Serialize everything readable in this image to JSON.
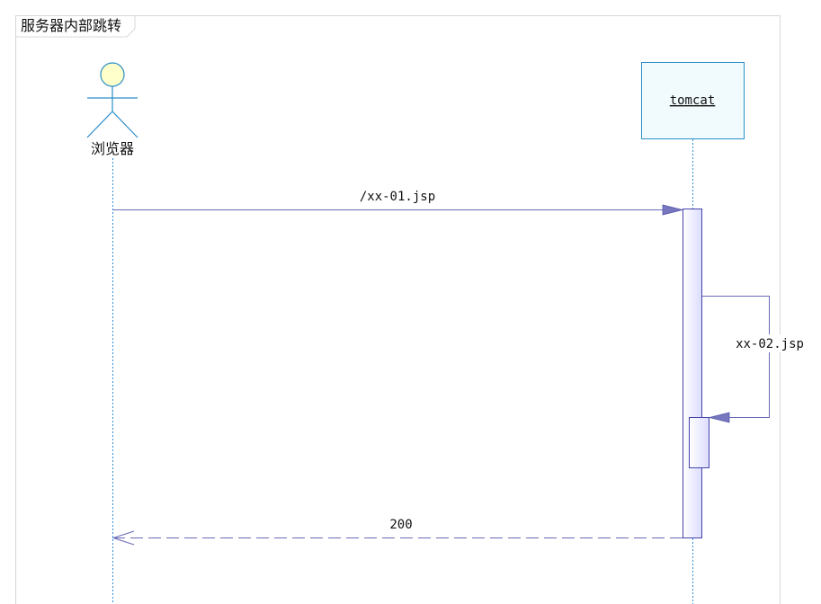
{
  "frame": {
    "title": "服务器内部跳转"
  },
  "participants": [
    {
      "id": "browser",
      "label": "浏览器",
      "kind": "actor"
    },
    {
      "id": "tomcat",
      "label": "tomcat",
      "kind": "object"
    }
  ],
  "messages": [
    {
      "label": "/xx-01.jsp",
      "from": "浏览器",
      "to": "tomcat",
      "style": "solid"
    },
    {
      "label": "xx-02.jsp",
      "from": "tomcat",
      "to": "tomcat",
      "style": "solid"
    },
    {
      "label": "200",
      "from": "tomcat",
      "to": "浏览器",
      "style": "dashed"
    }
  ],
  "colors": {
    "frame_border": "#d8d8d8",
    "lifeline": "#2f8fd8",
    "object_border": "#2a8fc8",
    "object_fill": "#f1fbfe",
    "actor_stroke": "#2a8fc8",
    "actor_head_fill": "#ffffcc",
    "message_line": "#6a6ab8",
    "arrow_fill": "#7777c0",
    "activation_border": "#4444aa",
    "activation_fill": "#e8e8ff"
  }
}
